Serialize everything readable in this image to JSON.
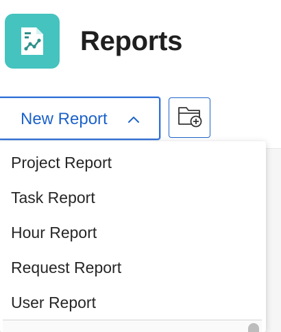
{
  "header": {
    "title": "Reports",
    "icon": "report-chart-icon",
    "icon_bg": "#45c3bf"
  },
  "toolbar": {
    "new_report_label": "New Report",
    "new_report_expanded": true,
    "chevron_icon": "chevron-up-icon",
    "folder_button_icon": "add-folder-icon",
    "accent": "#1d62c9"
  },
  "menu": {
    "items": [
      {
        "label": "Project Report"
      },
      {
        "label": "Task Report"
      },
      {
        "label": "Hour Report"
      },
      {
        "label": "Request Report"
      },
      {
        "label": "User Report"
      }
    ]
  }
}
